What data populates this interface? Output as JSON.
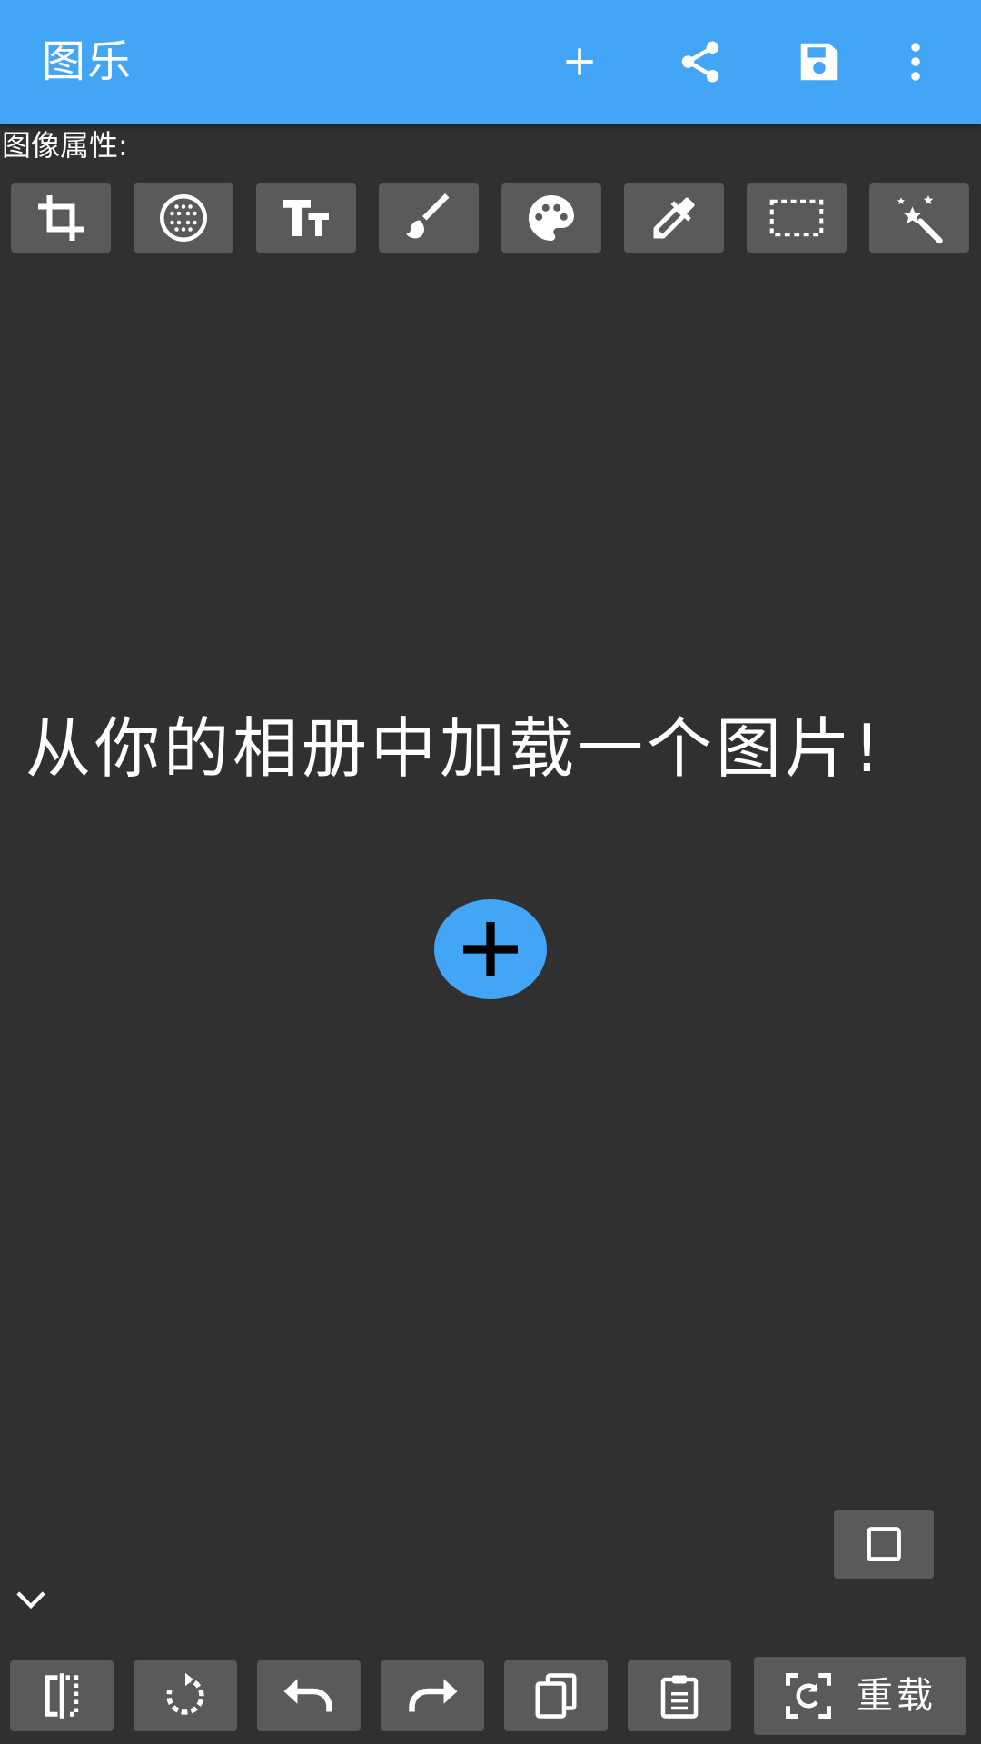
{
  "appbar": {
    "title": "图乐",
    "background_color": "#42a5f5",
    "actions": [
      {
        "icon": "add-icon"
      },
      {
        "icon": "share-icon"
      },
      {
        "icon": "save-icon"
      },
      {
        "icon": "more-vert-icon"
      }
    ]
  },
  "properties": {
    "label": "图像属性:",
    "tools": [
      {
        "icon": "crop-icon"
      },
      {
        "icon": "blur-icon"
      },
      {
        "icon": "text-size-icon"
      },
      {
        "icon": "brush-icon"
      },
      {
        "icon": "palette-icon"
      },
      {
        "icon": "eyedropper-icon"
      },
      {
        "icon": "selection-rect-icon"
      },
      {
        "icon": "magic-wand-icon"
      }
    ]
  },
  "canvas": {
    "prompt": "从你的相册中加载一个图片!",
    "fab_icon": "add-icon",
    "fab_color": "#42a5f5",
    "background_color": "#303030"
  },
  "aspect_button": {
    "icon": "square-outline-icon"
  },
  "collapse_button": {
    "icon": "chevron-down-icon"
  },
  "bottom_toolbar": {
    "buttons": [
      {
        "icon": "flip-icon"
      },
      {
        "icon": "rotate-icon"
      },
      {
        "icon": "undo-icon"
      },
      {
        "icon": "redo-icon"
      },
      {
        "icon": "copy-icon"
      },
      {
        "icon": "paste-icon"
      }
    ],
    "reload": {
      "icon": "reload-icon",
      "label": "重载"
    }
  },
  "button_color": "#5a5a5a"
}
